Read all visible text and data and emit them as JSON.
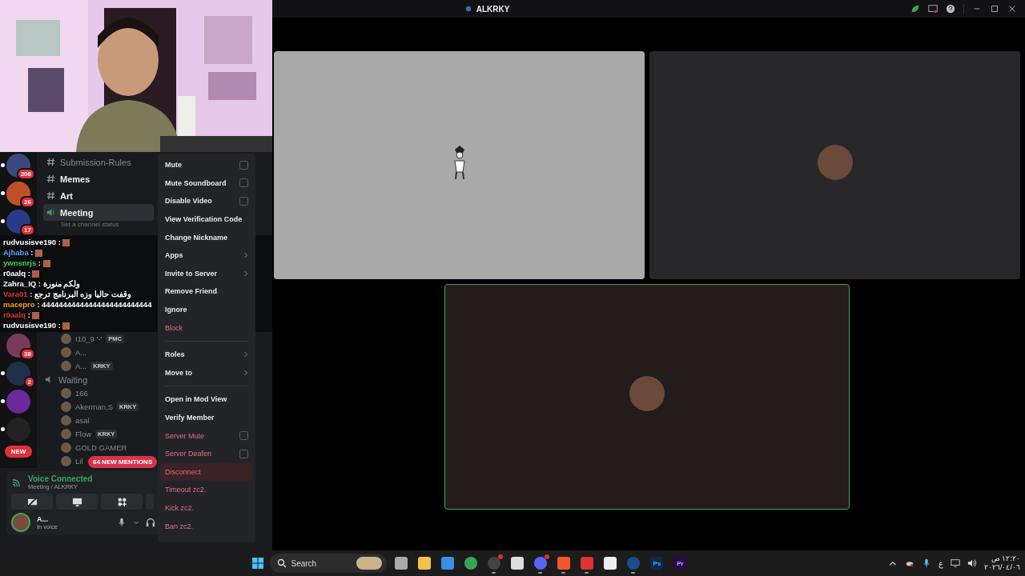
{
  "title_bar": {
    "title": "ALKRKY"
  },
  "webcam": {
    "kind": "picture"
  },
  "servers_top": [
    {
      "badge": "208",
      "unread": true
    },
    {
      "badge": "26",
      "unread": true
    },
    {
      "badge": "17",
      "unread": true
    }
  ],
  "servers_bottom": [
    {
      "badge": "38",
      "unread": false
    },
    {
      "badge": "2",
      "unread": true
    },
    {
      "unread": true
    },
    {
      "unread": true
    }
  ],
  "new_pill": "NEW",
  "channels": [
    {
      "name": "Submission-Rules",
      "kind": "text",
      "unread": false,
      "selected": false
    },
    {
      "name": "Memes",
      "kind": "text",
      "unread": true,
      "selected": false
    },
    {
      "name": "Art",
      "kind": "text",
      "unread": true,
      "selected": false
    },
    {
      "name": "Meeting",
      "kind": "voice",
      "unread": true,
      "selected": true,
      "status": "Set a channel status"
    }
  ],
  "chat": [
    {
      "user": "rudvusisve190",
      "sep": ":",
      "color": "#ffffff"
    },
    {
      "user": "Ajhaba",
      "sep": ":",
      "color": "#5aa0ff"
    },
    {
      "user": "ywnsnrjs",
      "sep": ":",
      "color": "#44cc66"
    },
    {
      "user": "r0aalq",
      "sep": ":",
      "color": "#ffffff"
    },
    {
      "user": "Zahra_IQ",
      "sep": ":",
      "color": "#ffffff",
      "text": "ولكم منورة"
    },
    {
      "user": "Vara01",
      "sep": ":",
      "color": "#e03030",
      "text": "وقفت حاليا وزه البرنامج ترجع"
    },
    {
      "user": "macepro",
      "sep": ":",
      "color": "#f0a020",
      "text": "44444444444444444444444444"
    },
    {
      "user": "r0aalq",
      "sep": ":",
      "color": "#e03030"
    },
    {
      "user": "rudvusisve190",
      "sep": ":",
      "color": "#ffffff"
    }
  ],
  "members": [
    {
      "kind": "member",
      "name": "I10_9 '-'",
      "tag": "PMC"
    },
    {
      "kind": "member",
      "name": "A..."
    },
    {
      "kind": "member",
      "name": "A...",
      "tag": "KRKY"
    },
    {
      "kind": "channel",
      "name": "Waiting"
    },
    {
      "kind": "member",
      "name": "166"
    },
    {
      "kind": "member",
      "name": "Akerman,S",
      "tag": "KRKY"
    },
    {
      "kind": "member",
      "name": "asal"
    },
    {
      "kind": "member",
      "name": "Flow",
      "tag": "KRKY"
    },
    {
      "kind": "member",
      "name": "GOLD GAMER"
    },
    {
      "kind": "member",
      "name": "Lil"
    }
  ],
  "mentions": "64 NEW MENTIONS",
  "voice": {
    "status": "Voice Connected",
    "channel": "Meeting / ALKRKY"
  },
  "user": {
    "name": "A...",
    "status": "In voice"
  },
  "menu": [
    [
      {
        "label": "Mute",
        "kind": "check",
        "danger": false,
        "checked": false,
        "highlighted": false
      },
      {
        "label": "Mute Soundboard",
        "kind": "check",
        "danger": false,
        "checked": false,
        "highlighted": false
      },
      {
        "label": "Disable Video",
        "kind": "check",
        "danger": false,
        "checked": false,
        "highlighted": false
      },
      {
        "label": "View Verification Code",
        "kind": "plain",
        "danger": false,
        "highlighted": false
      },
      {
        "label": "Change Nickname",
        "kind": "plain",
        "danger": false,
        "highlighted": false
      },
      {
        "label": "Apps",
        "kind": "submenu",
        "danger": false,
        "highlighted": false
      },
      {
        "label": "Invite to Server",
        "kind": "submenu",
        "danger": false,
        "highlighted": false
      },
      {
        "label": "Remove Friend",
        "kind": "plain",
        "danger": false,
        "highlighted": false
      },
      {
        "label": "Ignore",
        "kind": "plain",
        "danger": false,
        "highlighted": false
      },
      {
        "label": "Block",
        "kind": "plain",
        "danger": true,
        "highlighted": false
      }
    ],
    [
      {
        "label": "Roles",
        "kind": "submenu",
        "danger": false,
        "highlighted": false
      },
      {
        "label": "Move to",
        "kind": "submenu",
        "danger": false,
        "highlighted": false
      }
    ],
    [
      {
        "label": "Open in Mod View",
        "kind": "plain",
        "danger": false,
        "highlighted": false
      },
      {
        "label": "Verify Member",
        "kind": "plain",
        "danger": false,
        "highlighted": false
      },
      {
        "label": "Server Mute",
        "kind": "check",
        "danger": true,
        "checked": false,
        "highlighted": false
      },
      {
        "label": "Server Deafen",
        "kind": "check",
        "danger": true,
        "checked": false,
        "highlighted": false
      },
      {
        "label": "Disconnect",
        "kind": "plain",
        "danger": true,
        "highlighted": true
      },
      {
        "label": "Timeout zc2.",
        "kind": "plain",
        "danger": true,
        "highlighted": false
      },
      {
        "label": "Kick zc2.",
        "kind": "plain",
        "danger": true,
        "highlighted": false
      },
      {
        "label": "Ban zc2.",
        "kind": "plain",
        "danger": true,
        "highlighted": false
      }
    ]
  ],
  "videos": [
    {
      "kind": "light",
      "speaking": false
    },
    {
      "kind": "dark",
      "speaking": false
    },
    {
      "kind": "dark",
      "speaking": true
    }
  ],
  "taskbar": {
    "search": {
      "placeholder": "Search"
    },
    "apps": [
      {
        "kind": "taskview",
        "running": false,
        "alert": false
      },
      {
        "kind": "folder",
        "running": false,
        "alert": false
      },
      {
        "kind": "store",
        "running": false,
        "alert": false
      },
      {
        "kind": "chrome",
        "running": false,
        "alert": false
      },
      {
        "kind": "obs",
        "running": true,
        "alert": true
      },
      {
        "kind": "gear",
        "running": false,
        "alert": false
      },
      {
        "kind": "discord",
        "running": true,
        "alert": true
      },
      {
        "kind": "brave",
        "running": true,
        "alert": false
      },
      {
        "kind": "snip",
        "running": true,
        "alert": false
      },
      {
        "kind": "capcut",
        "running": false,
        "alert": false
      },
      {
        "kind": "steam",
        "running": true,
        "alert": false
      },
      {
        "kind": "ps",
        "label": "Ps",
        "running": false,
        "alert": false
      },
      {
        "kind": "pr",
        "label": "Pr",
        "running": false,
        "alert": false
      }
    ],
    "language": "ع",
    "time": "١٢:٢٠ ص",
    "date": "٢٠٢٦/٠٤/٠٦"
  }
}
